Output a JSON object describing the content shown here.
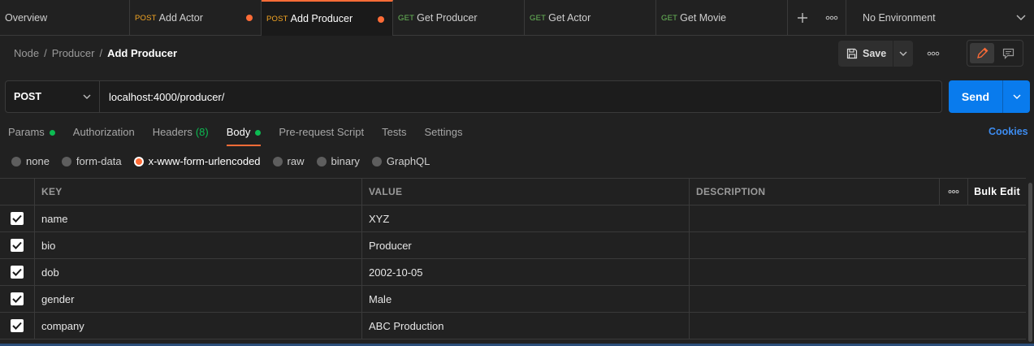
{
  "tabs": [
    {
      "method": "",
      "label": "Overview",
      "unsaved": false,
      "active": false
    },
    {
      "method": "POST",
      "label": "Add Actor",
      "unsaved": true,
      "active": false
    },
    {
      "method": "POST",
      "label": "Add Producer",
      "unsaved": true,
      "active": true
    },
    {
      "method": "GET",
      "label": "Get Producer",
      "unsaved": false,
      "active": false
    },
    {
      "method": "GET",
      "label": "Get Actor",
      "unsaved": false,
      "active": false
    },
    {
      "method": "GET",
      "label": "Get Movie",
      "unsaved": false,
      "active": false
    }
  ],
  "environment": {
    "label": "No Environment"
  },
  "breadcrumb": {
    "part1": "Node",
    "part2": "Producer",
    "current": "Add Producer",
    "sep": "/"
  },
  "header": {
    "save_label": "Save"
  },
  "request": {
    "method": "POST",
    "url": "localhost:4000/producer/",
    "send_label": "Send"
  },
  "request_tabs": {
    "params": "Params",
    "authorization": "Authorization",
    "headers": "Headers",
    "headers_count": "(8)",
    "body": "Body",
    "prerequest": "Pre-request Script",
    "tests": "Tests",
    "settings": "Settings",
    "cookies": "Cookies"
  },
  "body_types": [
    "none",
    "form-data",
    "x-www-form-urlencoded",
    "raw",
    "binary",
    "GraphQL"
  ],
  "body_type_selected": "x-www-form-urlencoded",
  "table": {
    "headers": {
      "key": "KEY",
      "value": "VALUE",
      "description": "DESCRIPTION",
      "bulk_edit": "Bulk Edit"
    },
    "rows": [
      {
        "key": "name",
        "value": "XYZ",
        "description": "",
        "checked": true
      },
      {
        "key": "bio",
        "value": "Producer",
        "description": "",
        "checked": true
      },
      {
        "key": "dob",
        "value": "2002-10-05",
        "description": "",
        "checked": true
      },
      {
        "key": "gender",
        "value": "Male",
        "description": "",
        "checked": true
      },
      {
        "key": "company",
        "value": "ABC Production",
        "description": "",
        "checked": true
      }
    ]
  },
  "colors": {
    "accent": "#ff6c37",
    "send": "#097bed",
    "post": "#f5a623",
    "get": "#6bbd5b",
    "indicator": "#0cbb52",
    "link": "#3d8cf0"
  }
}
